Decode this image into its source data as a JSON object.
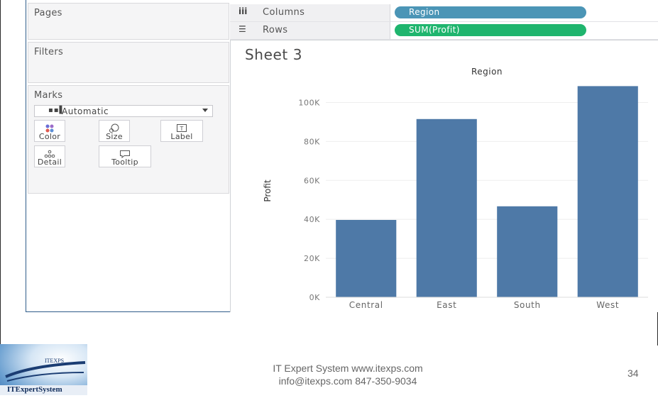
{
  "panes": {
    "pages_title": "Pages",
    "filters_title": "Filters",
    "marks_title": "Marks",
    "mark_type": "Automatic",
    "mark_buttons": [
      "Color",
      "Size",
      "Label",
      "Detail",
      "Tooltip"
    ]
  },
  "shelves": {
    "columns_label": "Columns",
    "columns_pill": "Region",
    "rows_label": "Rows",
    "rows_pill": "SUM(Profit)",
    "columns_pill_color": "#4b95b6",
    "rows_pill_color": "#1fb56e"
  },
  "sheet": {
    "title": "Sheet 3"
  },
  "chart_data": {
    "type": "bar",
    "title": "Region",
    "xlabel": "",
    "ylabel": "Profit",
    "categories": [
      "Central",
      "East",
      "South",
      "West"
    ],
    "values": [
      39700,
      91500,
      46700,
      108400
    ],
    "ylim": [
      0,
      110000
    ],
    "yticks": [
      0,
      20000,
      40000,
      60000,
      80000,
      100000
    ],
    "ytick_labels": [
      "0K",
      "20K",
      "40K",
      "60K",
      "80K",
      "100K"
    ],
    "bar_color": "#4e79a7",
    "grid": true
  },
  "footer": {
    "line1": "IT Expert System   www.itexps.com",
    "line2": "info@itexps.com  847-350-9034",
    "page_number": "34"
  },
  "logo": {
    "top_text": "ITEXPS",
    "bottom_text": "ITExpertSystem"
  }
}
